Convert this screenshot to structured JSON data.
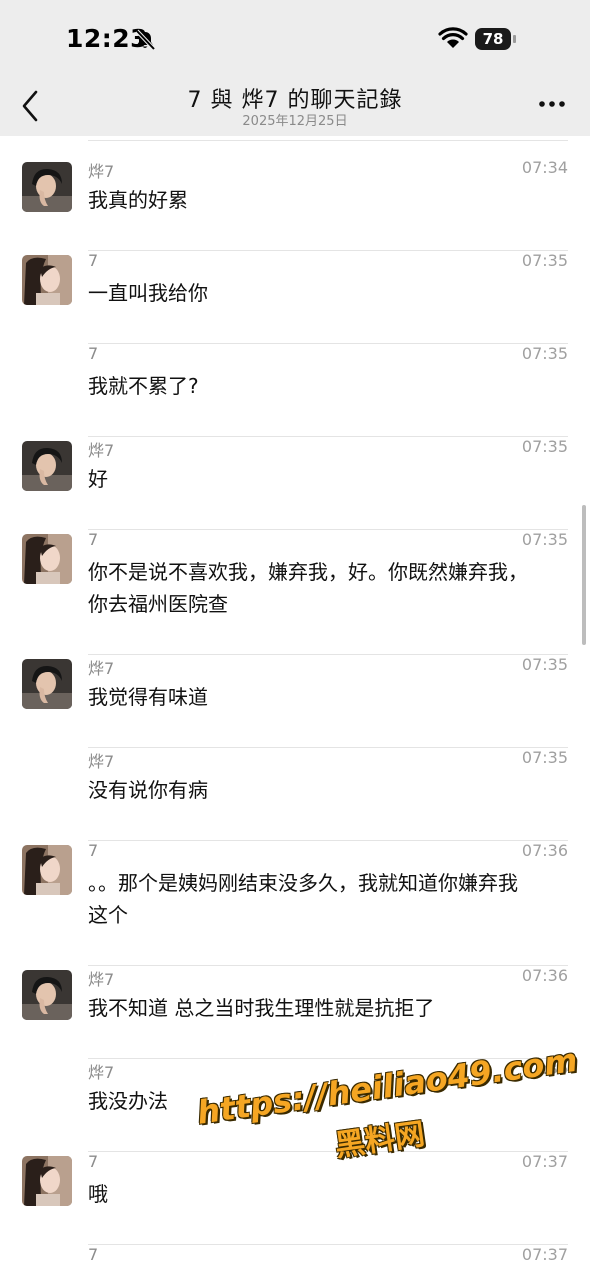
{
  "status_bar": {
    "time": "12:23",
    "battery": "78"
  },
  "header": {
    "title": "7 與 烨7 的聊天記錄",
    "date": "2025年12月25日"
  },
  "colors": {
    "bar_bg": "#ededed",
    "separator": "#e4e4e4",
    "watermark": "#f5a623"
  },
  "messages": [
    {
      "sender": "烨7",
      "time": "07:34",
      "lines": [
        "我真的好累"
      ],
      "avatar": "male"
    },
    {
      "sender": "7",
      "time": "07:35",
      "lines": [
        "一直叫我给你"
      ],
      "avatar": "female"
    },
    {
      "sender": "7",
      "time": "07:35",
      "lines": [
        "我就不累了?"
      ],
      "avatar": "none"
    },
    {
      "sender": "烨7",
      "time": "07:35",
      "lines": [
        "好"
      ],
      "avatar": "male"
    },
    {
      "sender": "7",
      "time": "07:35",
      "lines": [
        "你不是说不喜欢我，嫌弃我，好。你既然嫌弃我，",
        "你去福州医院查"
      ],
      "avatar": "female"
    },
    {
      "sender": "烨7",
      "time": "07:35",
      "lines": [
        "我觉得有味道"
      ],
      "avatar": "male"
    },
    {
      "sender": "烨7",
      "time": "07:35",
      "lines": [
        "没有说你有病"
      ],
      "avatar": "none"
    },
    {
      "sender": "7",
      "time": "07:36",
      "lines": [
        "。。那个是姨妈刚结束没多久，我就知道你嫌弃我",
        "这个"
      ],
      "avatar": "female"
    },
    {
      "sender": "烨7",
      "time": "07:36",
      "lines": [
        "我不知道 总之当时我生理性就是抗拒了"
      ],
      "avatar": "male"
    },
    {
      "sender": "烨7",
      "time": "07:36",
      "lines": [
        "我没办法"
      ],
      "avatar": "none"
    },
    {
      "sender": "7",
      "time": "07:37",
      "lines": [
        "哦"
      ],
      "avatar": "female"
    },
    {
      "sender": "7",
      "time": "07:37",
      "lines": [
        ""
      ],
      "avatar": "none"
    }
  ],
  "watermark": {
    "url": "https://heiliao49.com",
    "name": "黑料网"
  }
}
